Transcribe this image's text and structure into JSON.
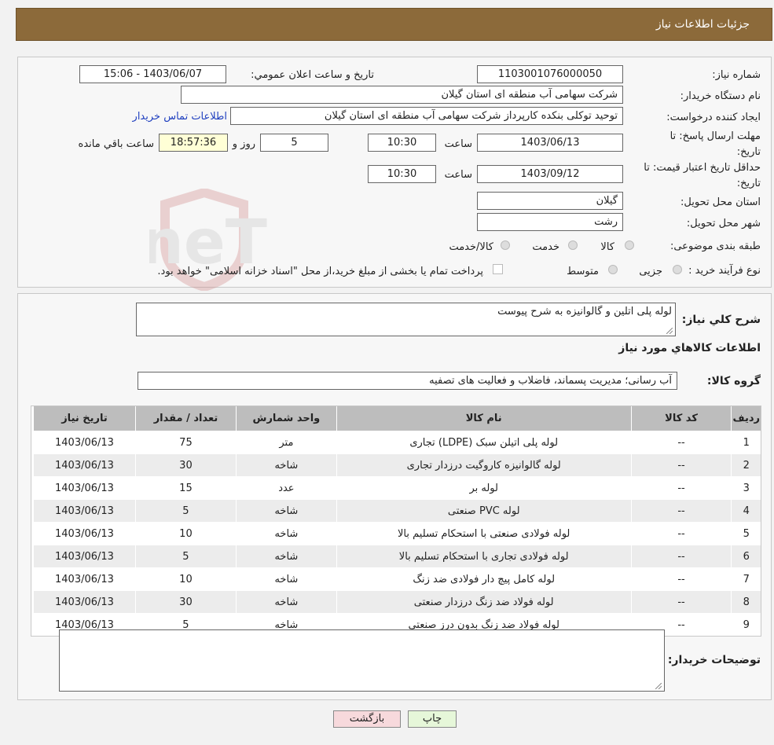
{
  "header": {
    "title": "جزئیات اطلاعات نیاز"
  },
  "form": {
    "need_number_label": "شماره نیاز:",
    "need_number": "1103001076000050",
    "announce_label": "تاریخ و ساعت اعلان عمومي:",
    "announce_value": "1403/06/07 - 15:06",
    "buyer_org_label": "نام دستگاه خريدار:",
    "buyer_org": "شرکت سهامی آب منطقه ای استان گیلان",
    "requester_label": "ايجاد کننده درخواست:",
    "requester": "توحید توکلی بنکده کارپرداز شرکت سهامی آب منطقه ای استان گیلان",
    "contact_link": "اطلاعات تماس خریدار",
    "deadline_label": "مهلت ارسال پاسخ: تا تاریخ:",
    "deadline_date": "1403/06/13",
    "time_label": "ساعت",
    "deadline_time": "10:30",
    "days_value": "5",
    "days_label": "روز و",
    "remaining_time": "18:57:36",
    "remaining_label": "ساعت باقي مانده",
    "validity_label": "حداقل تاریخ اعتبار قیمت: تا تاریخ:",
    "validity_date": "1403/09/12",
    "validity_time": "10:30",
    "province_label": "استان محل تحویل:",
    "province": "گیلان",
    "city_label": "شهر محل تحویل:",
    "city": "رشت",
    "category_label": "طبقه بندی موضوعی:",
    "category_options": [
      "کالا",
      "خدمت",
      "کالا/خدمت"
    ],
    "process_label": "نوع فرآیند خرید :",
    "process_options": [
      "جزیی",
      "متوسط"
    ],
    "process_note": "پرداخت تمام یا بخشی از مبلغ خرید،از محل \"اسناد خزانه اسلامی\" خواهد بود."
  },
  "summary": {
    "label": "شرح كلي نياز:",
    "value": "لوله پلی اتلین و گالوانیزه به شرح پیوست",
    "goods_info_title": "اطلاعات كالاهاي مورد نياز",
    "group_label": "گروه کالا:",
    "group_value": "آب رسانی؛ مدیریت پسماند، فاضلاب و فعالیت های تصفیه"
  },
  "table": {
    "headers": [
      "رديف",
      "کد کالا",
      "نام کالا",
      "واحد شمارش",
      "تعداد / مقدار",
      "تاریخ نیاز"
    ],
    "rows": [
      [
        "1",
        "--",
        "لوله پلی اتیلن سبک (LDPE) تجاری",
        "متر",
        "75",
        "1403/06/13"
      ],
      [
        "2",
        "--",
        "لوله گالوانیزه کاروگیت درزدار تجاری",
        "شاخه",
        "30",
        "1403/06/13"
      ],
      [
        "3",
        "--",
        "لوله بر",
        "عدد",
        "15",
        "1403/06/13"
      ],
      [
        "4",
        "--",
        "لوله PVC صنعتی",
        "شاخه",
        "5",
        "1403/06/13"
      ],
      [
        "5",
        "--",
        "لوله فولادی صنعتی با استحکام تسلیم بالا",
        "شاخه",
        "10",
        "1403/06/13"
      ],
      [
        "6",
        "--",
        "لوله فولادی تجاری با استحکام تسلیم بالا",
        "شاخه",
        "5",
        "1403/06/13"
      ],
      [
        "7",
        "--",
        "لوله کامل پیچ دار فولادی ضد زنگ",
        "شاخه",
        "10",
        "1403/06/13"
      ],
      [
        "8",
        "--",
        "لوله فولاد ضد زنگ درزدار صنعتی",
        "شاخه",
        "30",
        "1403/06/13"
      ],
      [
        "9",
        "--",
        "لوله فولاد ضد زنگ بدون درز صنعتی",
        "شاخه",
        "5",
        "1403/06/13"
      ]
    ]
  },
  "buyer_notes": {
    "label": "توضیحات خریدار:",
    "value": ""
  },
  "buttons": {
    "print": "چاپ",
    "back": "بازگشت"
  },
  "watermark": {
    "text": "AriaTender.neT"
  }
}
